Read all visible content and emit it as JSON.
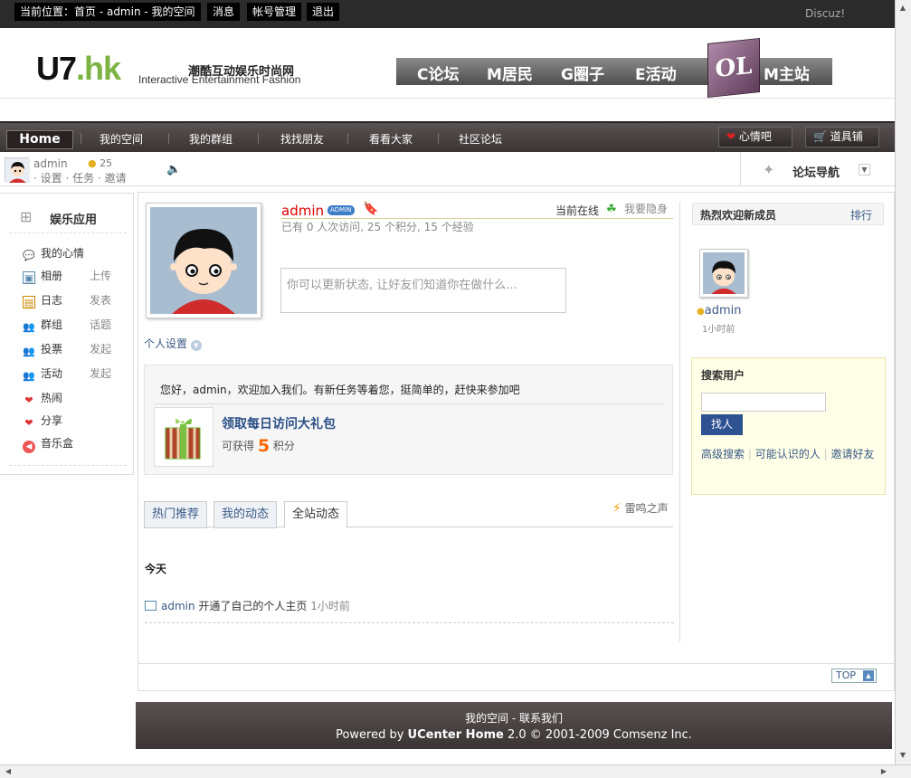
{
  "topbar": {
    "location": "当前位置：首页 - admin - 我的空间",
    "messages": "消息",
    "account": "帐号管理",
    "logout": "退出",
    "discuz": "Discuz!"
  },
  "header": {
    "logo_u7": "U7",
    "logo_dot": ".",
    "logo_hk": "hk",
    "slogan_cn": "潮酷互动娱乐时尚网",
    "slogan_en": "Interactive Entertainment Fashion",
    "site_links": [
      "C论坛",
      "M居民",
      "G圈子",
      "E活动",
      "M主站"
    ],
    "ol_logo": "OL"
  },
  "mainnav": {
    "home": "Home",
    "items": [
      "我的空间",
      "我的群组",
      "找找朋友",
      "看看大家",
      "社区论坛"
    ],
    "mood_bar": "心情吧",
    "props": "道具铺"
  },
  "userbar": {
    "username": "admin",
    "credits": "25",
    "links": "设置 · 任务 · 邀请",
    "forum_nav": "论坛导航"
  },
  "apps": {
    "title": "娱乐应用",
    "items": [
      {
        "label": "我的心情",
        "action": ""
      },
      {
        "label": "相册",
        "action": "上传"
      },
      {
        "label": "日志",
        "action": "发表"
      },
      {
        "label": "群组",
        "action": "话题"
      },
      {
        "label": "投票",
        "action": "发起"
      },
      {
        "label": "活动",
        "action": "发起"
      },
      {
        "label": "热闹",
        "action": ""
      },
      {
        "label": "分享",
        "action": ""
      },
      {
        "label": "音乐盒",
        "action": ""
      }
    ]
  },
  "profile": {
    "name": "admin",
    "badge": "ADMIN",
    "online_status": "当前在线",
    "hide_link": "我要隐身",
    "stats": "已有 0 人次访问, 25 个积分, 15 个经验",
    "status_placeholder": "你可以更新状态, 让好友们知道你在做什么...",
    "settings": "个人设置"
  },
  "task": {
    "welcome": "您好，admin，欢迎加入我们。有新任务等着您，挺简单的，赶快来参加吧",
    "title": "领取每日访问大礼包",
    "reward_prefix": "可获得",
    "reward_value": "5",
    "reward_suffix": "积分"
  },
  "tabs": {
    "items": [
      "热门推荐",
      "我的动态",
      "全站动态"
    ],
    "active": "全站动态",
    "thunder": "雷鸣之声"
  },
  "feed": {
    "section": "今天",
    "user": "admin",
    "action": " 开通了自己的个人主页 ",
    "time": "1小时前"
  },
  "new_members": {
    "title": "热烈欢迎新成员",
    "rank": "排行",
    "name": "admin",
    "time": "1小时前"
  },
  "search": {
    "title": "搜索用户",
    "button": "找人",
    "adv": "高级搜索",
    "maybe": "可能认识的人",
    "invite": "邀请好友"
  },
  "footer": {
    "line1_a": "我的空间",
    "line1_b": " - 联系我们",
    "powered": "Powered by ",
    "product": "UCenter Home",
    "version": " 2.0 © 2001-2009 Comsenz Inc."
  },
  "top_button": "TOP"
}
